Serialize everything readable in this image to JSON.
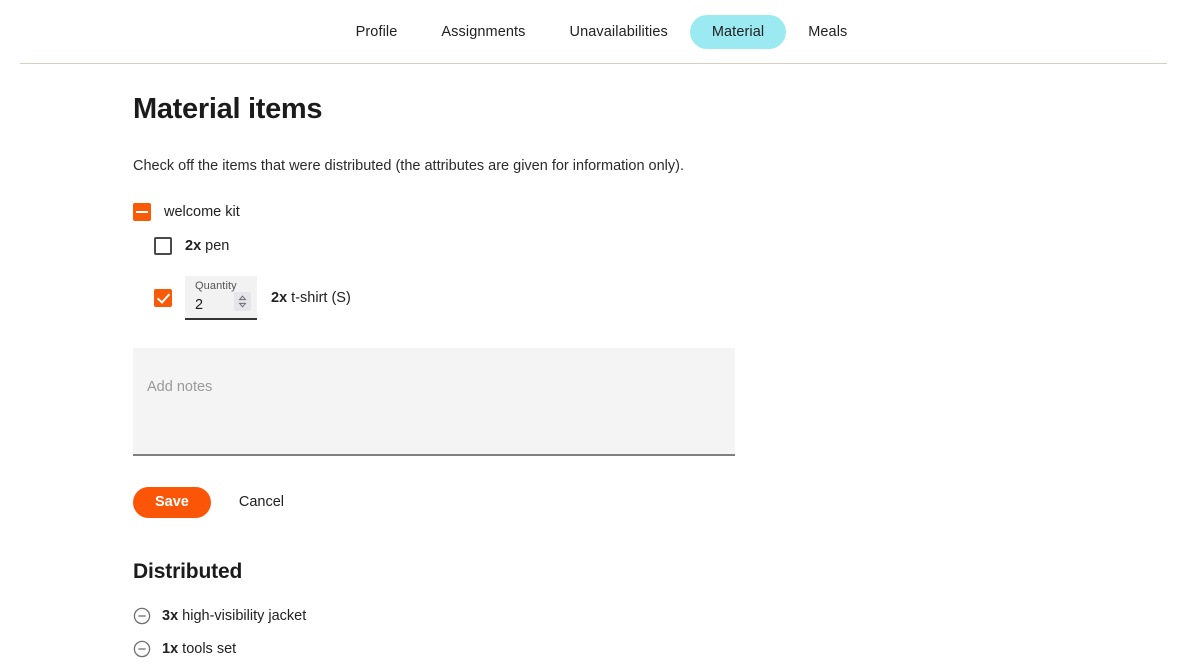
{
  "nav": {
    "tabs": [
      {
        "label": "Profile",
        "active": false
      },
      {
        "label": "Assignments",
        "active": false
      },
      {
        "label": "Unavailabilities",
        "active": false
      },
      {
        "label": "Material",
        "active": true
      },
      {
        "label": "Meals",
        "active": false
      }
    ],
    "active_tab_color": "#9beaf2"
  },
  "main": {
    "title": "Material items",
    "subtitle": "Check off the items that were distributed (the attributes are given for information only).",
    "items": [
      {
        "label": "welcome kit",
        "state": "indeterminate",
        "level": 0,
        "quantity_prefix": ""
      },
      {
        "label": "pen",
        "state": "unchecked",
        "level": 1,
        "quantity_prefix": "2x"
      },
      {
        "label": "t-shirt (S)",
        "state": "checked",
        "level": 1,
        "quantity_prefix": "2x",
        "quantity_field": {
          "label": "Quantity",
          "value": "2"
        }
      }
    ],
    "notes": {
      "value": "",
      "placeholder": "Add notes"
    },
    "save_label": "Save",
    "cancel_label": "Cancel",
    "accent_color": "#fb5607"
  },
  "distributed": {
    "title": "Distributed",
    "items": [
      {
        "quantity_prefix": "3x",
        "label": "high-visibility jacket",
        "icon": "circle-minus-icon"
      },
      {
        "quantity_prefix": "1x",
        "label": "tools set",
        "icon": "circle-minus-icon"
      }
    ]
  }
}
